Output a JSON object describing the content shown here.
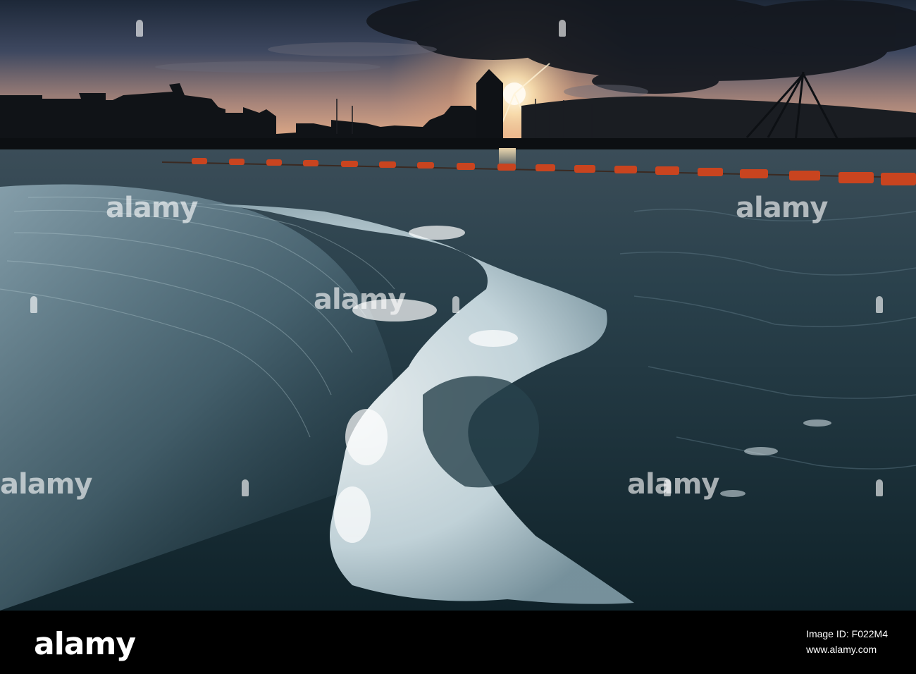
{
  "photo": {
    "subject": "river-barrage-sunset",
    "colors": {
      "sky_top": "#2c3a4f",
      "sky_horizon": "#e7a47a",
      "sun": "#fff5d6",
      "water_dark": "#16303a",
      "water_sheen": "#8aa8b4",
      "foam": "#e9f2f5",
      "buoys": "#d64a24",
      "silhouette": "#0e1216"
    }
  },
  "watermark": {
    "text": "alamy"
  },
  "footer": {
    "logo": "alamy",
    "image_id_label": "Image ID: F022M4",
    "site": "www.alamy.com"
  }
}
